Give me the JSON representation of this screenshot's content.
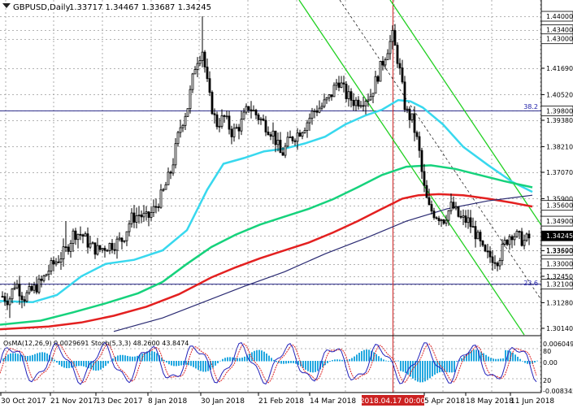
{
  "header": {
    "symbol_label": "GBPUSD,Daily",
    "ohlc": "1.33717 1.34467 1.33687 1.34245"
  },
  "price_axis": {
    "ticks": [
      "1.44000",
      "1.43400",
      "1.43000",
      "1.41690",
      "1.40520",
      "1.39800",
      "1.39380",
      "1.38210",
      "1.37070",
      "1.35900",
      "1.35600",
      "1.34900",
      "1.34245",
      "1.33600",
      "1.33590",
      "1.33000",
      "1.32450",
      "1.32100",
      "1.31280",
      "1.30140"
    ],
    "boxed": [
      "1.44000",
      "1.43400",
      "1.43000",
      "1.39800",
      "1.35600",
      "1.34900",
      "1.34245",
      "1.33600",
      "1.33000",
      "1.32100"
    ],
    "ylim": [
      1.2985,
      1.4465
    ]
  },
  "fib_labels": {
    "upper": "38.2",
    "lower": "23.6"
  },
  "vertical_marker": {
    "label": "2018.04.17 00:00"
  },
  "time_axis": [
    "30 Oct 2017",
    "21 Nov 2017",
    "13 Dec 2017",
    "8 Jan 2018",
    "30 Jan 2018",
    "21 Feb 2018",
    "14 Mar 2018",
    "5 Apr 2018",
    "18 May 2018",
    "11 Jun 2018"
  ],
  "sub_panel": {
    "label": "OsMA(12,26,9) 0.0029691  Stoch(5,3,3) 48.2600 43.8474",
    "right_ticks": [
      "0.006049",
      "80",
      "0.00",
      "20",
      "-0.008345"
    ]
  },
  "colors": {
    "candle": "#000000",
    "ma_fast": "#38d8ee",
    "ma_mid": "#16d27c",
    "ma_slow": "#e32020",
    "ma_long": "#2a2a72",
    "channel": "#22d022",
    "osma": "#22a8e0",
    "stoch_main": "#2222bb",
    "stoch_signal": "#dd2222",
    "marker": "#cc2222"
  }
}
